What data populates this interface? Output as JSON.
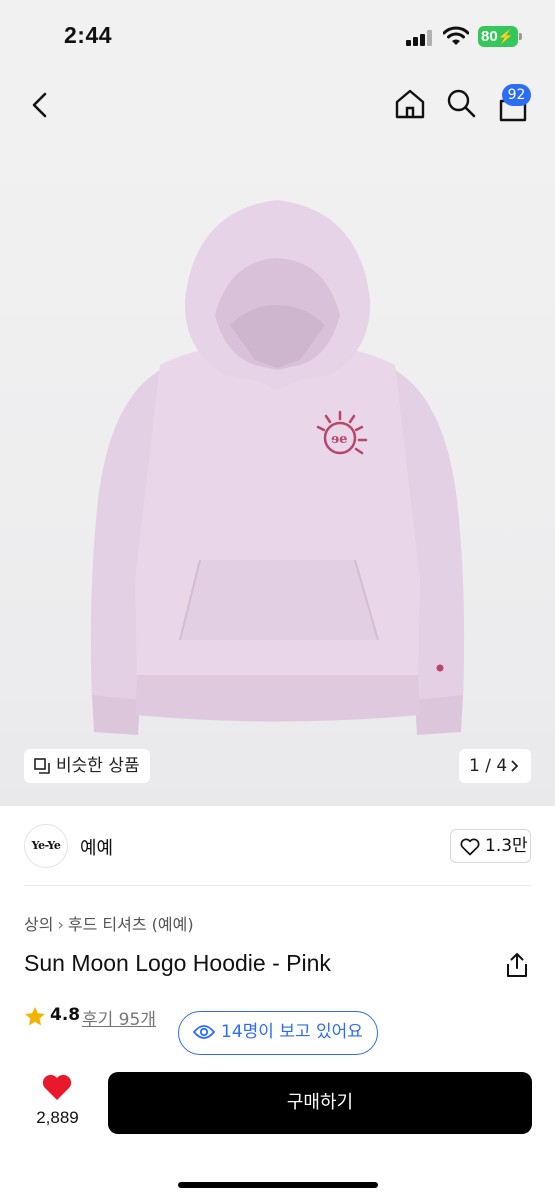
{
  "status": {
    "time": "2:44",
    "battery": "80"
  },
  "nav": {
    "cart_count": "92",
    "icons": [
      "back-icon",
      "home-icon",
      "search-icon",
      "cart-icon"
    ]
  },
  "hero": {
    "similar_label": "비슷한 상품",
    "counter": "1 / 4"
  },
  "brand": {
    "logo_text": "Ye-Ye",
    "name": "예예",
    "likes": "1.3만"
  },
  "product": {
    "breadcrumb": [
      "상의",
      "후드 티셔츠 (예예)"
    ],
    "title": "Sun Moon Logo Hoodie - Pink",
    "rating": "4.8",
    "reviews": "후기 95개",
    "viewing": "14명이 보고 있어요"
  },
  "bottom": {
    "wish_count": "2,889",
    "buy_label": "구매하기"
  },
  "colors": {
    "accent": "#2d6df6",
    "heart": "#e8192c",
    "star": "#f5b300",
    "hoodie": "#e6d3e6",
    "logo": "#b8456a"
  }
}
